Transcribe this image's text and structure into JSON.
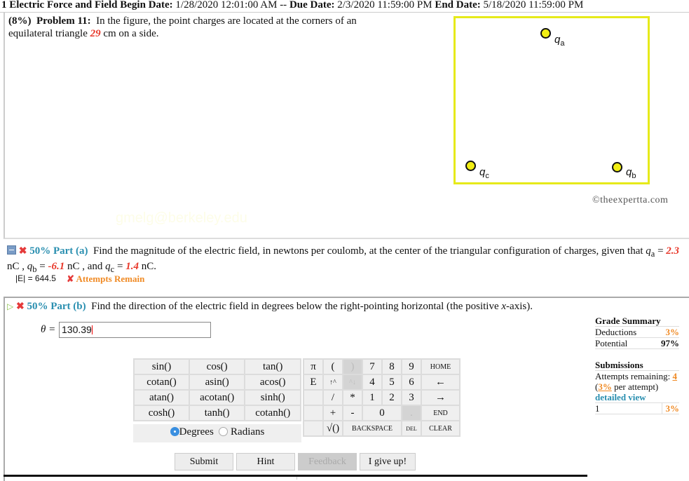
{
  "header": {
    "assignment": "1 Electric Force and Field",
    "begin_label": "Begin Date:",
    "begin_value": "1/28/2020 12:01:00 AM",
    "sep": "--",
    "due_label": "Due Date:",
    "due_value": "2/3/2020 11:59:00 PM",
    "end_label": "End Date:",
    "end_value": "5/18/2020 11:59:00 PM"
  },
  "problem": {
    "weight": "(8%)",
    "title": "Problem 11:",
    "text_before": "In the figure, the point charges are located at the corners of an equilateral triangle",
    "side_value": "29",
    "text_after": "cm on a side."
  },
  "figure": {
    "charges": [
      {
        "name": "q",
        "sub": "a"
      },
      {
        "name": "q",
        "sub": "b"
      },
      {
        "name": "q",
        "sub": "c"
      }
    ],
    "border_color": "#e6ea1a",
    "charge_color": "#f1ee13",
    "copyright": "©theexpertta.com"
  },
  "watermark": "gmelg@berkeley.edu",
  "part_a": {
    "percent": "50%",
    "label": "Part (a)",
    "text": "Find the magnitude of the electric field, in newtons per coulomb, at the center of the triangular configuration of charges, given that",
    "qa_value": "2.3",
    "qb_value": "-6.1",
    "qc_value": "1.4",
    "unit": "nC",
    "answer_label": "|E| = 644.5",
    "status": "Attempts Remain"
  },
  "part_b": {
    "percent": "50%",
    "label": "Part (b)",
    "text_before": "Find the direction of the electric field in degrees below the right-pointing horizontal (the positive",
    "axis": "x",
    "text_after": "-axis).",
    "variable": "θ =",
    "input_value": "130.39"
  },
  "keypad": {
    "trig": [
      [
        "sin()",
        "cos()",
        "tan()"
      ],
      [
        "cotan()",
        "asin()",
        "acos()"
      ],
      [
        "atan()",
        "acotan()",
        "sinh()"
      ],
      [
        "cosh()",
        "tanh()",
        "cotanh()"
      ]
    ],
    "mode_options": [
      "Degrees",
      "Radians"
    ],
    "mode_selected": "Degrees",
    "pi": "π",
    "open": "(",
    "close": ")",
    "n7": "7",
    "n8": "8",
    "n9": "9",
    "home": "HOME",
    "e": "E",
    "up": "↑^",
    "down": "^↓",
    "n4": "4",
    "n5": "5",
    "n6": "6",
    "left": "←",
    "div": "/",
    "mul": "*",
    "n1": "1",
    "n2": "2",
    "n3": "3",
    "right": "→",
    "plus": "+",
    "minus": "-",
    "n0": "0",
    "dot": ".",
    "end": "END",
    "sqrt": "√()",
    "backspace": "BACKSPACE",
    "del": "DEL",
    "clear": "CLEAR"
  },
  "buttons": {
    "submit": "Submit",
    "hint": "Hint",
    "feedback": "Feedback",
    "giveup": "I give up!"
  },
  "grade": {
    "title": "Grade Summary",
    "deductions_label": "Deductions",
    "deductions_value": "3%",
    "potential_label": "Potential",
    "potential_value": "97%",
    "submissions_title": "Submissions",
    "attempts_label": "Attempts remaining:",
    "attempts_value": "4",
    "per_attempt_value": "3%",
    "per_attempt_label": "per attempt)",
    "detailed_view": "detailed view",
    "history": [
      {
        "num": "1",
        "value": "3%"
      }
    ]
  }
}
